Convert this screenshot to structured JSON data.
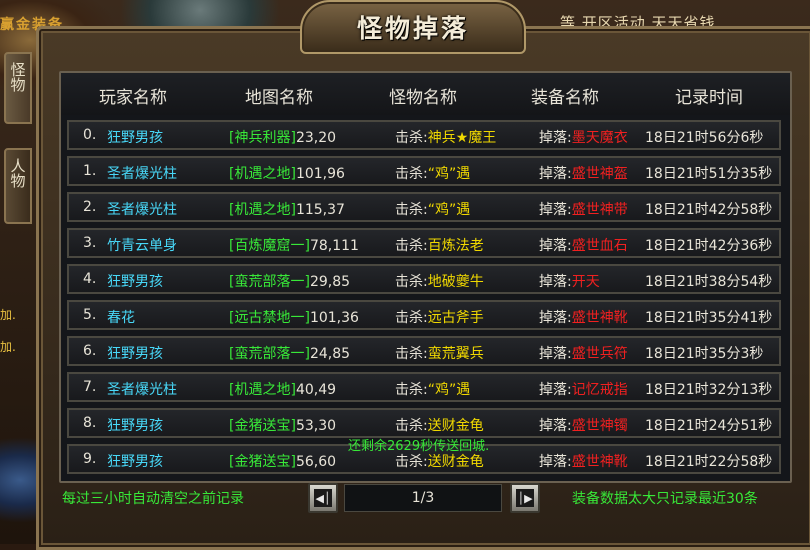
{
  "background": {
    "top_left_text": "赢金装备",
    "top_right_text": "等   开区活动   天天省钱",
    "left_snippets": [
      "加.",
      "加."
    ]
  },
  "window": {
    "title": "怪物掉落",
    "side_tabs": [
      "怪物",
      "人物"
    ]
  },
  "table": {
    "headers": [
      "玩家名称",
      "地图名称",
      "怪物名称",
      "装备名称",
      "记录时间"
    ],
    "rows": [
      {
        "idx": "0.",
        "player": "狂野男孩",
        "map": "神兵利器",
        "coord": "23,20",
        "kill_prefix": "击杀:",
        "monster": "神兵★魔王",
        "drop_prefix": "掉落:",
        "equip": "墨天魔衣",
        "time": "18日21时56分6秒"
      },
      {
        "idx": "1.",
        "player": "圣者爆光柱",
        "map": "机遇之地",
        "coord": "101,96",
        "kill_prefix": "击杀:",
        "monster": "“鸡”遇",
        "drop_prefix": "掉落:",
        "equip": "盛世神盔",
        "time": "18日21时51分35秒"
      },
      {
        "idx": "2.",
        "player": "圣者爆光柱",
        "map": "机遇之地",
        "coord": "115,37",
        "kill_prefix": "击杀:",
        "monster": "“鸡”遇",
        "drop_prefix": "掉落:",
        "equip": "盛世神带",
        "time": "18日21时42分58秒"
      },
      {
        "idx": "3.",
        "player": "竹青云单身",
        "map": "百炼魔窟一",
        "coord": "78,111",
        "kill_prefix": "击杀:",
        "monster": "百炼法老",
        "drop_prefix": "掉落:",
        "equip": "盛世血石",
        "time": "18日21时42分36秒"
      },
      {
        "idx": "4.",
        "player": "狂野男孩",
        "map": "蛮荒部落一",
        "coord": "29,85",
        "kill_prefix": "击杀:",
        "monster": "地破夔牛",
        "drop_prefix": "掉落:",
        "equip": "开天",
        "time": "18日21时38分54秒"
      },
      {
        "idx": "5.",
        "player": "春花",
        "map": "远古禁地一",
        "coord": "101,36",
        "kill_prefix": "击杀:",
        "monster": "远古斧手",
        "drop_prefix": "掉落:",
        "equip": "盛世神靴",
        "time": "18日21时35分41秒"
      },
      {
        "idx": "6.",
        "player": "狂野男孩",
        "map": "蛮荒部落一",
        "coord": "24,85",
        "kill_prefix": "击杀:",
        "monster": "蛮荒翼兵",
        "drop_prefix": "掉落:",
        "equip": "盛世兵符",
        "time": "18日21时35分3秒"
      },
      {
        "idx": "7.",
        "player": "圣者爆光柱",
        "map": "机遇之地",
        "coord": "40,49",
        "kill_prefix": "击杀:",
        "monster": "“鸡”遇",
        "drop_prefix": "掉落:",
        "equip": "记忆戒指",
        "time": "18日21时32分13秒"
      },
      {
        "idx": "8.",
        "player": "狂野男孩",
        "map": "金猪送宝",
        "coord": "53,30",
        "kill_prefix": "击杀:",
        "monster": "送财金龟",
        "drop_prefix": "掉落:",
        "equip": "盛世神镯",
        "time": "18日21时24分51秒"
      },
      {
        "idx": "9.",
        "player": "狂野男孩",
        "map": "金猪送宝",
        "coord": "56,60",
        "kill_prefix": "击杀:",
        "monster": "送财金龟",
        "drop_prefix": "掉落:",
        "equip": "盛世神靴",
        "time": "18日21时22分58秒"
      }
    ]
  },
  "floating_message": "还剩余2629秒传送回城.",
  "footer": {
    "left_note": "每过三小时自动清空之前记录",
    "page": "1/3",
    "right_note": "装备数据太大只记录最近30条"
  },
  "colors": {
    "player": "#48d8f8",
    "map_bracket": "#38e838",
    "monster": "#f0d800",
    "equip": "#f02020",
    "note": "#38e838"
  }
}
